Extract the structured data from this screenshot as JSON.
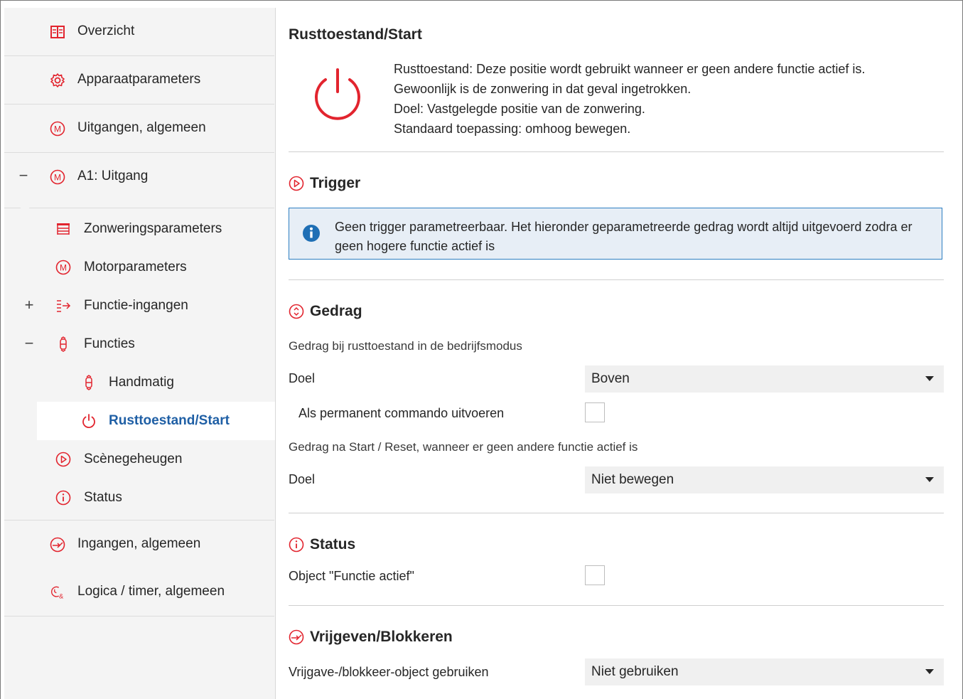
{
  "sidebar": {
    "top": [
      {
        "label": "Overzicht",
        "icon": "overview-icon"
      },
      {
        "label": "Apparaatparameters",
        "icon": "gear-icon"
      },
      {
        "label": "Uitgangen, algemeen",
        "icon": "motor-icon"
      },
      {
        "label": "A1: Uitgang",
        "icon": "motor-icon",
        "expander": "−"
      }
    ],
    "sub": [
      {
        "label": "Zonweringsparameters",
        "icon": "blind-icon"
      },
      {
        "label": "Motorparameters",
        "icon": "motor-icon"
      },
      {
        "label": "Functie-ingangen",
        "icon": "function-input-icon",
        "expander": "+"
      },
      {
        "label": "Functies",
        "icon": "functions-icon",
        "expander": "−"
      },
      {
        "label": "Handmatig",
        "icon": "manual-icon"
      },
      {
        "label": "Rusttoestand/Start",
        "icon": "power-icon"
      },
      {
        "label": "Scènegeheugen",
        "icon": "scene-icon"
      },
      {
        "label": "Status",
        "icon": "status-icon"
      }
    ],
    "bottom": [
      {
        "label": "Ingangen, algemeen",
        "icon": "input-icon"
      },
      {
        "label": "Logica / timer, algemeen",
        "icon": "logic-timer-icon"
      }
    ]
  },
  "main": {
    "title": "Rusttoestand/Start",
    "description": [
      "Rusttoestand: Deze positie wordt gebruikt wanneer er geen andere functie actief is.",
      "Gewoonlijk is de zonwering in dat geval ingetrokken.",
      "Doel: Vastgelegde positie van de zonwering.",
      "Standaard toepassing: omhoog bewegen."
    ],
    "trigger": {
      "title": "Trigger",
      "info": "Geen trigger parametreerbaar. Het hieronder geparametreerde gedrag wordt altijd uitgevoerd zodra er geen hogere functie actief is"
    },
    "gedrag": {
      "title": "Gedrag",
      "sub1": "Gedrag bij rusttoestand in de bedrijfsmodus",
      "doel1_label": "Doel",
      "doel1_value": "Boven",
      "permanent_label": "Als permanent commando uitvoeren",
      "sub2": "Gedrag na Start / Reset, wanneer er geen andere functie actief is",
      "doel2_label": "Doel",
      "doel2_value": "Niet bewegen"
    },
    "status": {
      "title": "Status",
      "object_label": "Object \"Functie actief\""
    },
    "vrijgeven": {
      "title": "Vrijgeven/Blokkeren",
      "label": "Vrijgave-/blokkeer-object gebruiken",
      "value": "Niet gebruiken"
    }
  },
  "colors": {
    "accent_red": "#e2242e",
    "active_blue": "#1f5fa5",
    "info_blue": "#2d7fc2"
  }
}
